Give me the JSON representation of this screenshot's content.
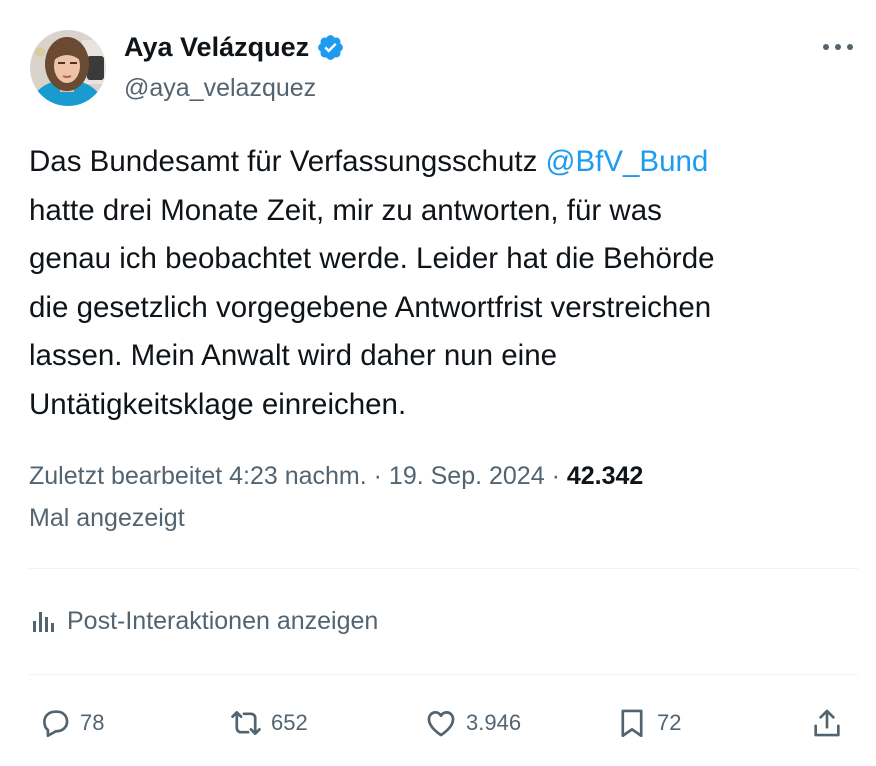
{
  "author": {
    "display_name": "Aya Velázquez",
    "handle": "@aya_velazquez",
    "verified_icon": "verified-badge-icon",
    "accent_color": "#1d9bf0"
  },
  "tweet": {
    "text_before_mention": "Das Bundesamt für Verfassungsschutz ",
    "mention": "@BfV_Bund",
    "text_after_mention": "\nhatte drei Monate Zeit, mir zu antworten, für was\ngenau ich beobachtet werde. Leider hat die Behörde\ndie gesetzlich vorgegebene Antwortfrist verstreichen\nlassen. Mein Anwalt wird daher nun eine\nUntätigkeitsklage einreichen."
  },
  "meta": {
    "edited_time": "Zuletzt bearbeitet 4:23 nachm.",
    "separator": " · ",
    "date": "19. Sep. 2024",
    "views_count": "42.342",
    "views_label": "Mal angezeigt"
  },
  "analytics": {
    "label": "Post-Interaktionen anzeigen",
    "icon": "bar-chart-icon"
  },
  "actions": {
    "replies": "78",
    "reposts": "652",
    "likes": "3.946",
    "bookmarks": "72"
  },
  "colors": {
    "text": "#0f1419",
    "secondary_text": "#536471",
    "link": "#1d9bf0",
    "divider": "#eff3f4"
  }
}
